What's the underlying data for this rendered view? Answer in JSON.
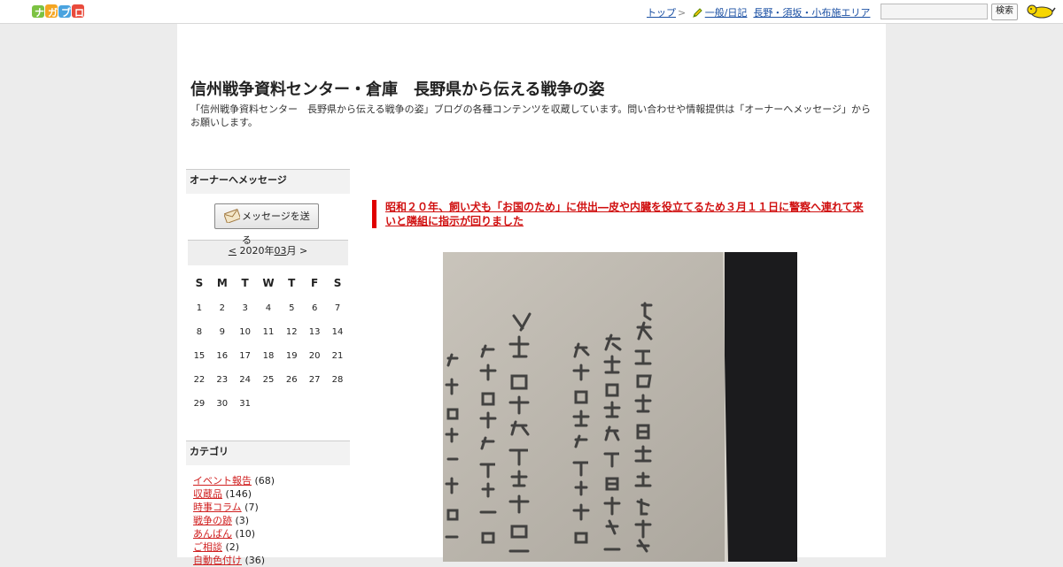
{
  "topbar": {
    "logo_text": "ナガブロ",
    "nav": {
      "top": "トップ",
      "sep": ">",
      "genre": "一般/日記",
      "area": "長野・須坂・小布施エリア"
    },
    "search_button": "検索",
    "search_placeholder": ""
  },
  "blog": {
    "title": "信州戦争資料センター・倉庫　長野県から伝える戦争の姿",
    "description": "「信州戦争資料センター　長野県から伝える戦争の姿」ブログの各種コンテンツを収蔵しています。問い合わせや情報提供は「オーナーへメッセージ」からお願いします。"
  },
  "sidebar": {
    "owner_heading": "オーナーへメッセージ",
    "message_button": "メッセージを送る",
    "calendar": {
      "prev": "<",
      "year_label": "2020年",
      "month": "03",
      "month_suffix": "月",
      "next": ">",
      "weekdays": [
        "S",
        "M",
        "T",
        "W",
        "T",
        "F",
        "S"
      ],
      "weeks": [
        [
          "1",
          "2",
          "3",
          "4",
          "5",
          "6",
          "7"
        ],
        [
          "8",
          "9",
          "10",
          "11",
          "12",
          "13",
          "14"
        ],
        [
          "15",
          "16",
          "17",
          "18",
          "19",
          "20",
          "21"
        ],
        [
          "22",
          "23",
          "24",
          "25",
          "26",
          "27",
          "28"
        ],
        [
          "29",
          "30",
          "31",
          "",
          "",
          "",
          ""
        ]
      ]
    },
    "category_heading": "カテゴリ",
    "categories": [
      {
        "name": "イベント報告",
        "count": "(68)"
      },
      {
        "name": "収蔵品",
        "count": "(146)"
      },
      {
        "name": "時事コラム",
        "count": "(7)"
      },
      {
        "name": "戦争の跡",
        "count": "(3)"
      },
      {
        "name": "あんばん",
        "count": "(10)"
      },
      {
        "name": "ご相談",
        "count": "(2)"
      },
      {
        "name": "自動色付け",
        "count": "(36)"
      }
    ]
  },
  "post": {
    "title": "昭和２０年、飼い犬も「お国のため」に供出―皮や内臓を役立てるため３月１１日に警察へ連れて来いと隣組に指示が回りました"
  },
  "colors": {
    "accent_red": "#e00000",
    "link_blue": "#1a4fa3",
    "category_link": "#d02020"
  }
}
